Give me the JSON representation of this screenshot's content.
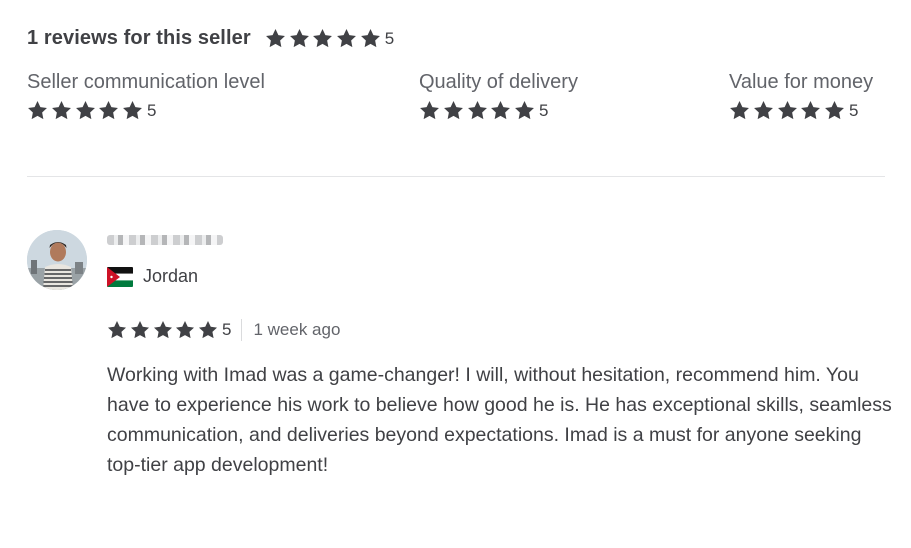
{
  "summary": {
    "title": "1 reviews for this seller",
    "rating": "5",
    "stars": 5
  },
  "breakdown": [
    {
      "label": "Seller communication level",
      "rating": "5"
    },
    {
      "label": "Quality of delivery",
      "rating": "5"
    },
    {
      "label": "Value for money",
      "rating": "5"
    }
  ],
  "review": {
    "country": "Jordan",
    "rating": "5",
    "time": "1 week ago",
    "text": "Working with Imad was a game-changer! I will, without hesitation, recommend him. You have to experience his work to believe how good he is. He has exceptional skills, seamless communication, and deliveries beyond expectations. Imad is a must for anyone seeking top-tier app development!"
  },
  "colors": {
    "star": "#404145",
    "text": "#404145",
    "muted": "#62646a",
    "divider": "#e4e5e7"
  },
  "icons": {
    "star": "star-icon",
    "flag": "jordan-flag-icon",
    "avatar": "user-avatar"
  }
}
